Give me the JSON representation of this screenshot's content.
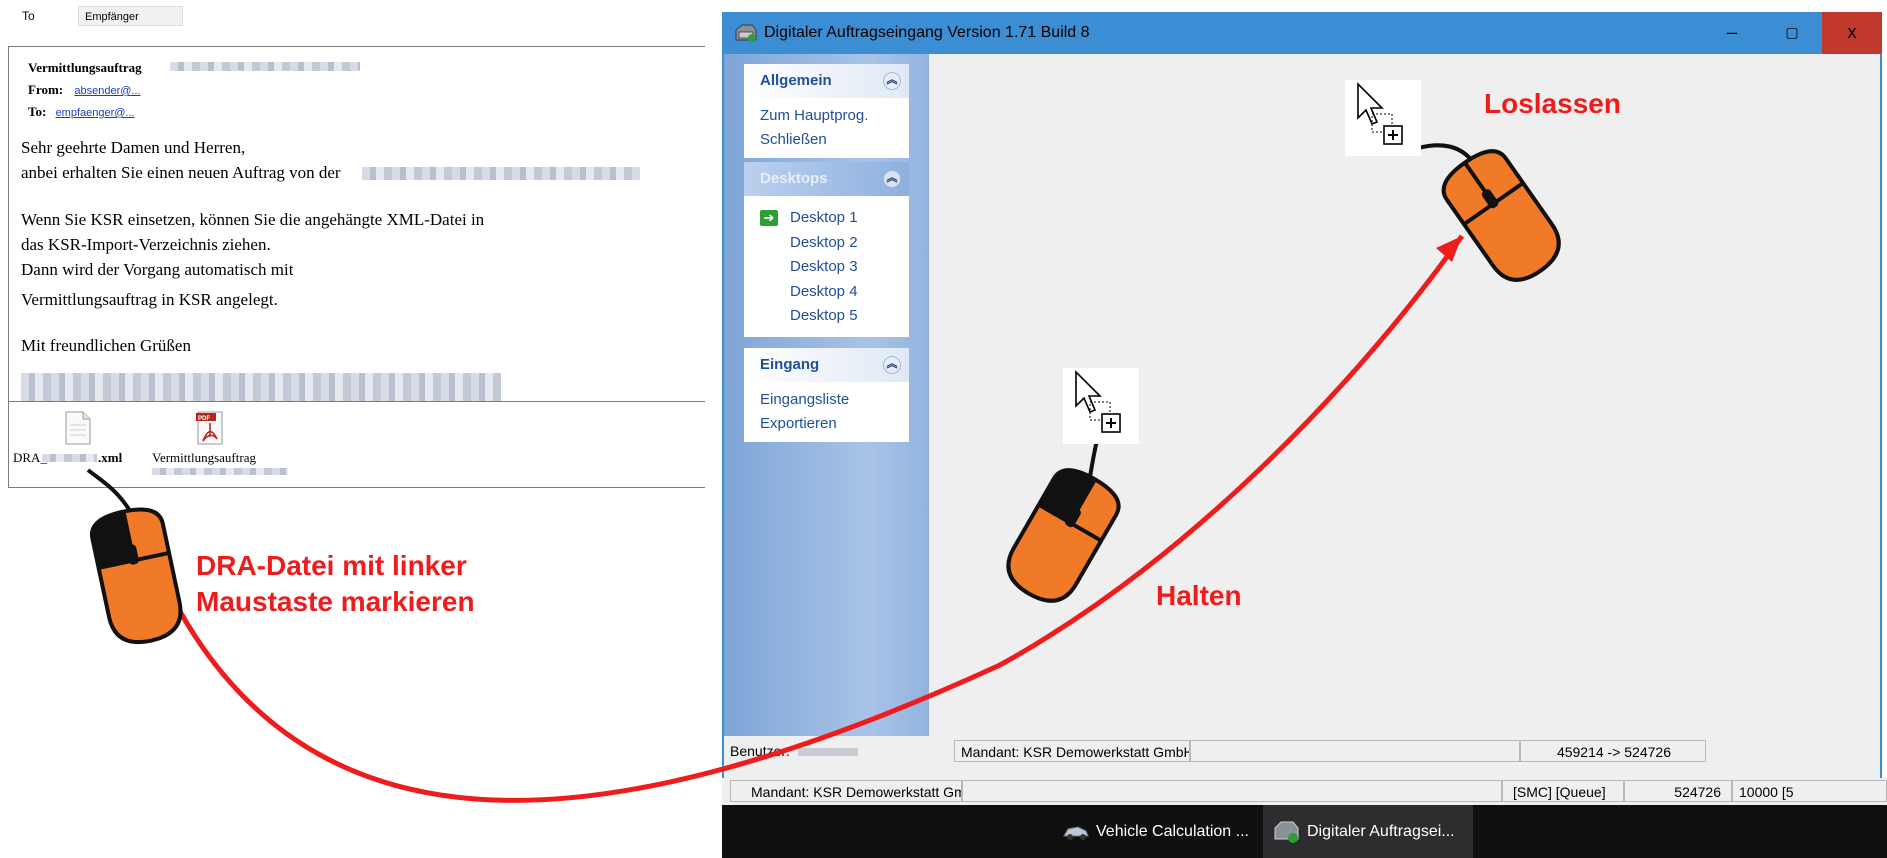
{
  "email": {
    "to_label": "To",
    "to_value": "Empfänger",
    "subject": "Vermittlungsauftrag",
    "from_label": "From:",
    "from_value": "absender@...",
    "to2_label": "To:",
    "to2_value": "empfaenger@...",
    "body_lines": [
      "Sehr geehrte Damen und Herren,",
      "anbei erhalten Sie einen neuen Auftrag von der",
      "Wenn Sie KSR einsetzen, können Sie die angehängte XML-Datei in",
      "das KSR-Import-Verzeichnis ziehen.",
      "Dann wird der Vorgang automatisch mit",
      "Vermittlungsauftrag in KSR angelegt.",
      "Mit freundlichen Grüßen"
    ],
    "attachments": [
      {
        "name_prefix": "DRA_",
        "name_suffix": ".xml",
        "icon": "xml-file-icon"
      },
      {
        "name": "Vermittlungsauftrag",
        "icon": "pdf-file-icon"
      }
    ]
  },
  "app": {
    "title": "Digitaler Auftragseingang Version  1.71 Build 8",
    "window_buttons": {
      "minimize": "–",
      "maximize": "▢",
      "close": "x"
    },
    "groups": [
      {
        "title": "Allgemein",
        "items": [
          "Zum Hauptprog.",
          "Schließen"
        ]
      },
      {
        "title": "Desktops",
        "items": [
          "Desktop 1",
          "Desktop 2",
          "Desktop 3",
          "Desktop 4",
          "Desktop 5"
        ],
        "active_index": 0
      },
      {
        "title": "Eingang",
        "items": [
          "Eingangsliste",
          "Exportieren"
        ]
      }
    ],
    "status_inner": {
      "user_label": "Benutzer:",
      "mandant": "Mandant: KSR Demowerkstatt GmbH",
      "ids": "459214 -> 524726"
    },
    "status_outer": {
      "mandant": "Mandant: KSR Demowerkstatt GmbH",
      "queue": "[SMC] [Queue]",
      "id": "524726",
      "extra": "10000 [5"
    }
  },
  "taskbar": {
    "items": [
      {
        "label": "Vehicle Calculation ...",
        "icon": "car-icon"
      },
      {
        "label": "Digitaler Auftragsei...",
        "icon": "app-icon",
        "active": true
      }
    ]
  },
  "annotations": {
    "step1": [
      "DRA-Datei mit linker",
      "Maustaste markieren"
    ],
    "step2": "Halten",
    "step3": "Loslassen",
    "accent_color": "#ee1c1c",
    "mouse_color": "#f07a28"
  }
}
